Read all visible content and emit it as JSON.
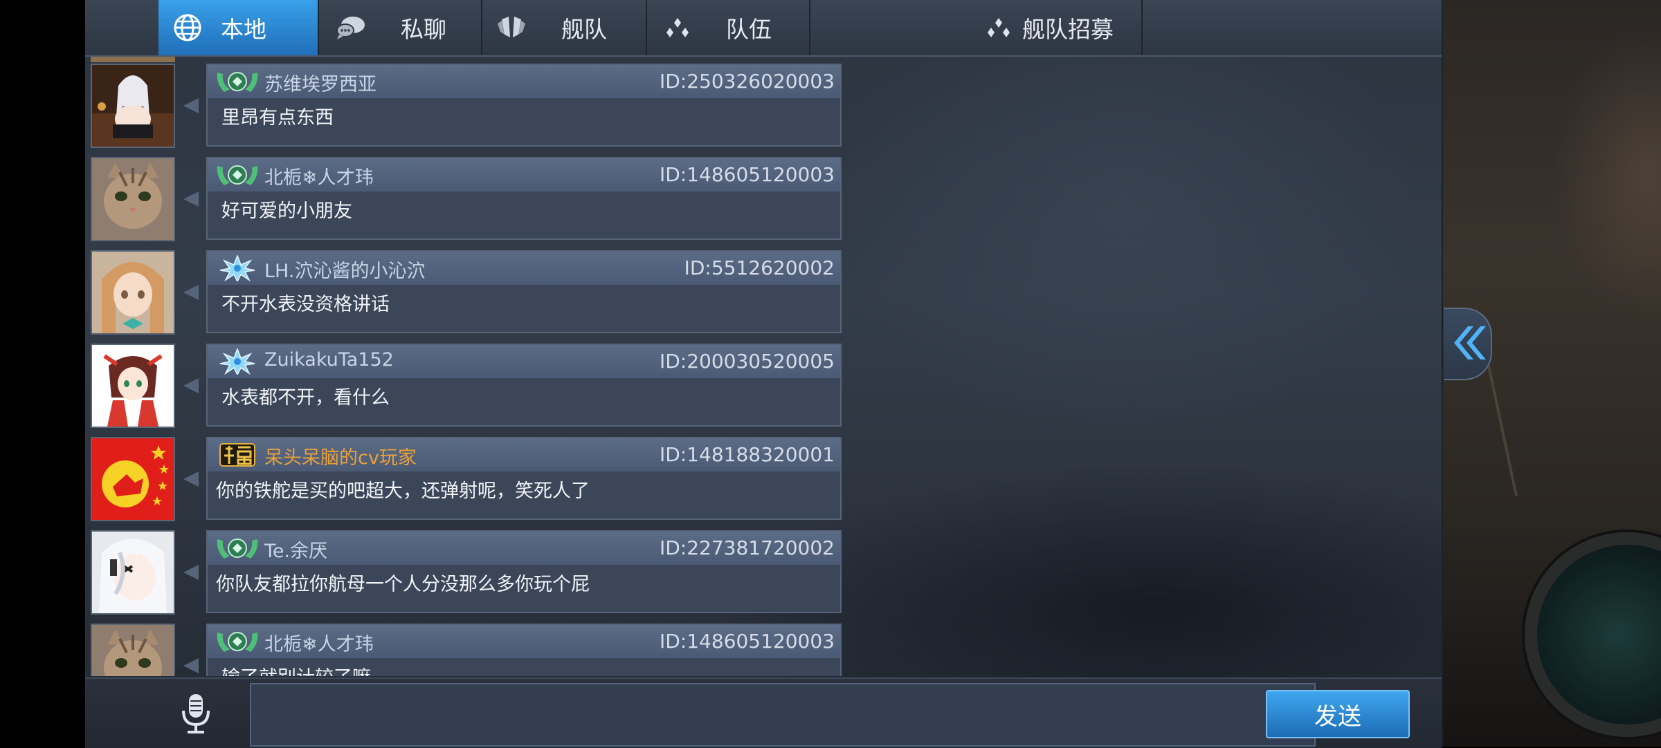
{
  "tabs": [
    {
      "label": "本地",
      "icon": "globe-icon",
      "active": true
    },
    {
      "label": "私聊",
      "icon": "chat-bubbles-icon",
      "active": false
    },
    {
      "label": "舰队",
      "icon": "fleet-emblem-icon",
      "active": false
    },
    {
      "label": "队伍",
      "icon": "team-dots-icon",
      "active": false
    },
    {
      "label": "舰队招募",
      "icon": "team-dots-icon",
      "active": false
    }
  ],
  "messages": [
    {
      "name": "苏维埃罗西亚",
      "id": "ID:250326020003",
      "text": "里昂有点东西",
      "badge": "green-wreath-badge",
      "avatar": "anime-girl-avatar"
    },
    {
      "name": "北栀❄人才玮",
      "id": "ID:148605120003",
      "text": "好可爱的小朋友",
      "badge": "green-wreath-badge",
      "avatar": "cat-avatar"
    },
    {
      "name": "LH.泬沁酱的小沁泬",
      "id": "ID:5512620002",
      "text": "不开水表没资格讲话",
      "badge": "blue-snowflake-badge",
      "avatar": "anime-blonde-avatar"
    },
    {
      "name": "ZuikakuTa152",
      "id": "ID:200030520005",
      "text": "水表都不开，看什么",
      "badge": "blue-snowflake-badge",
      "avatar": "anime-shrine-maiden-avatar"
    },
    {
      "name": "呆头呆脑的cv玩家",
      "id": "ID:148188320001",
      "text": "你的铁舵是买的吧超大，还弹射呢，笑死人了",
      "badge": "fu-character-badge",
      "avatar": "red-flag-avatar"
    },
    {
      "name": "Te.余厌",
      "id": "ID:227381720002",
      "text": "你队友都拉你航母一个人分没那么多你玩个屁",
      "badge": "green-wreath-badge",
      "avatar": "white-hair-anime-avatar"
    },
    {
      "name": "北栀❄人才玮",
      "id": "ID:148605120003",
      "text": "输了就别计较了嘛",
      "badge": "green-wreath-badge",
      "avatar": "cat-avatar"
    }
  ],
  "input": {
    "placeholder": "",
    "value": ""
  },
  "send_label": "发送",
  "colors": {
    "accent": "#2f8fdc",
    "gold_name": "#e9a13a",
    "name": "#c9d5e6"
  }
}
